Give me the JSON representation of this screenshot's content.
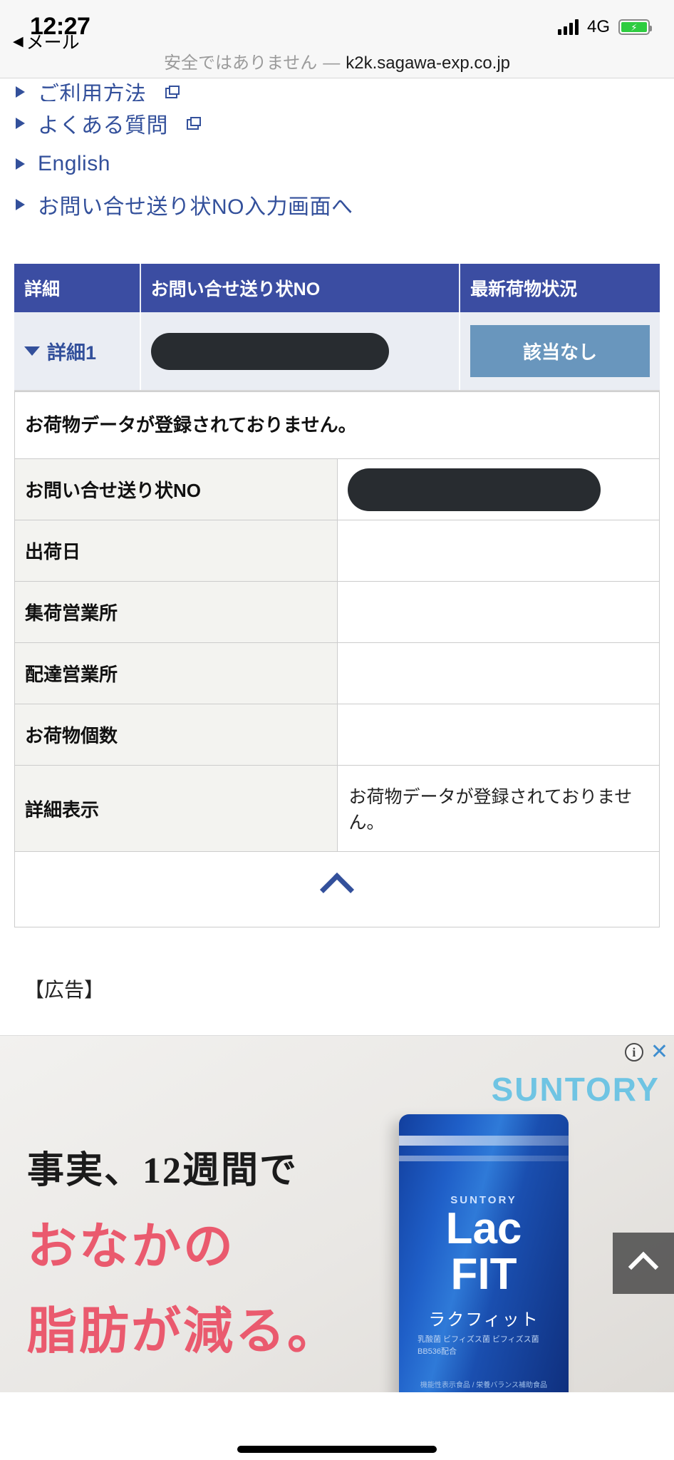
{
  "status_bar": {
    "time": "12:27",
    "back_label": "メール",
    "back_arrow": "◀",
    "network": "4G",
    "battery_icon": "battery-charging",
    "signal_icon": "signal-bars"
  },
  "browser": {
    "security_warning": "安全ではありません",
    "separator": "—",
    "url": "k2k.sagawa-exp.co.jp"
  },
  "nav_links": [
    {
      "label": "ご利用方法",
      "external": true
    },
    {
      "label": "よくある質問",
      "external": true
    },
    {
      "label": "English",
      "external": false
    },
    {
      "label": "お問い合せ送り状NO入力画面へ",
      "external": false
    }
  ],
  "tracking_table": {
    "headers": [
      "詳細",
      "お問い合せ送り状NO",
      "最新荷物状況"
    ],
    "rows": [
      {
        "detail_label": "詳細1",
        "tracking_number": "",
        "tracking_redacted": true,
        "status": "該当なし"
      }
    ]
  },
  "detail_panel": {
    "notice": "お荷物データが登録されておりません。",
    "fields": [
      {
        "label": "お問い合せ送り状NO",
        "value": "",
        "redacted": true
      },
      {
        "label": "出荷日",
        "value": "",
        "redacted": false
      },
      {
        "label": "集荷営業所",
        "value": "",
        "redacted": false
      },
      {
        "label": "配達営業所",
        "value": "",
        "redacted": false
      },
      {
        "label": "お荷物個数",
        "value": "",
        "redacted": false
      },
      {
        "label": "詳細表示",
        "value": "お荷物データが登録されておりません。",
        "redacted": false
      }
    ],
    "collapse_icon": "chevron-up-icon"
  },
  "advertisement": {
    "section_label": "【広告】",
    "adchoices_icon": "info-icon",
    "close_icon": "close-icon",
    "brand": "SUNTORY",
    "copy_line1": "事実、12週間で",
    "copy_line2": "おなかの",
    "copy_line3": "脂肪が減る。",
    "product": {
      "brand_small": "SUNTORY",
      "name_line1": "Lac",
      "name_line2": "FIT",
      "name_kana": "ラクフィット",
      "fine_print": "乳酸菌 ビフィズス菌\nビフィズス菌 BB536配合",
      "bottom_print": "機能性表示食品 / 栄養バランス補助食品"
    }
  },
  "scroll_top_button": {
    "icon": "chevron-up-icon"
  },
  "colors": {
    "header_blue": "#3b4da2",
    "link_blue": "#33509b",
    "badge_blue": "#6996bd",
    "row_gray": "#eaedf3",
    "label_gray": "#f3f3f0",
    "redaction_black": "#282c30",
    "ad_pink": "#ea5a6e",
    "suntory_cyan": "#6fc4e3"
  }
}
